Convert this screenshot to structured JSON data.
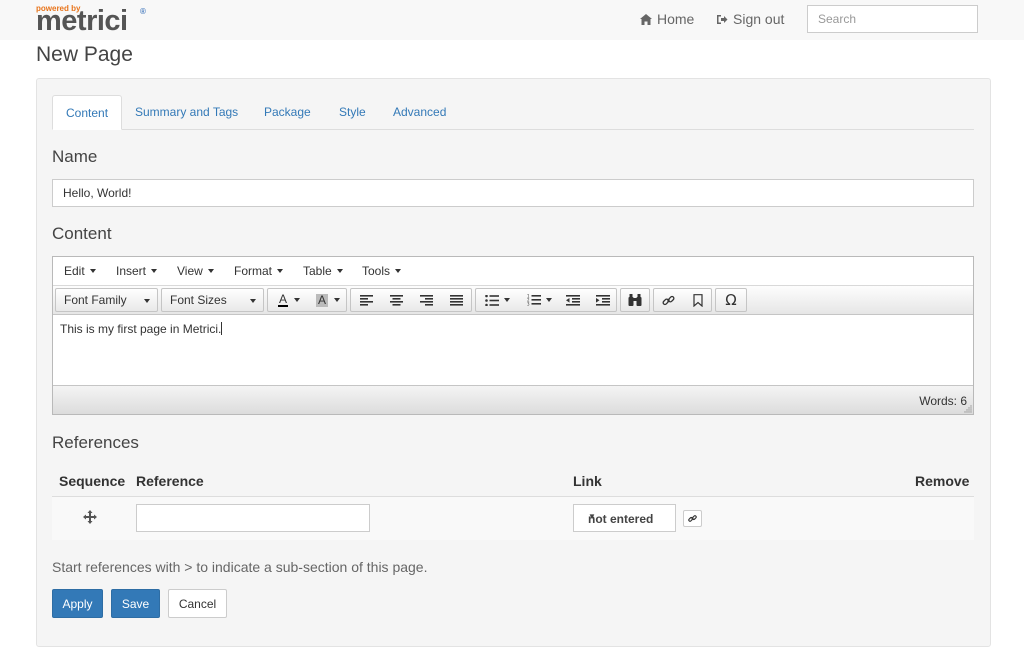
{
  "brand": {
    "powered_by": "powered by",
    "name": "metrici",
    "trademark": "®"
  },
  "nav": {
    "home_label": "Home",
    "signout_label": "Sign out",
    "search_placeholder": "Search"
  },
  "page": {
    "title": "New Page"
  },
  "tabs": [
    {
      "label": "Content",
      "active": true
    },
    {
      "label": "Summary and Tags",
      "active": false
    },
    {
      "label": "Package",
      "active": false
    },
    {
      "label": "Style",
      "active": false
    },
    {
      "label": "Advanced",
      "active": false
    }
  ],
  "name_section": {
    "label": "Name",
    "value": "Hello, World!"
  },
  "content_section": {
    "label": "Content",
    "menus": [
      "Edit",
      "Insert",
      "View",
      "Format",
      "Table",
      "Tools"
    ],
    "font_family_label": "Font Family",
    "font_sizes_label": "Font Sizes",
    "text_color_glyph": "A",
    "bg_color_glyph": "A",
    "special_char_glyph": "Ω",
    "body_text": "This is my first page in Metrici.",
    "word_count": "Words: 6"
  },
  "references": {
    "label": "References",
    "columns": {
      "sequence": "Sequence",
      "reference": "Reference",
      "link": "Link",
      "remove": "Remove"
    },
    "rows": [
      {
        "reference": "",
        "link": "not entered"
      }
    ],
    "help_text": "Start references with > to indicate a sub-section of this page."
  },
  "actions": {
    "apply": "Apply",
    "save": "Save",
    "cancel": "Cancel"
  },
  "colors": {
    "primary": "#3379b7",
    "brand_orange": "#e8741b",
    "brand_grey": "#555555"
  }
}
